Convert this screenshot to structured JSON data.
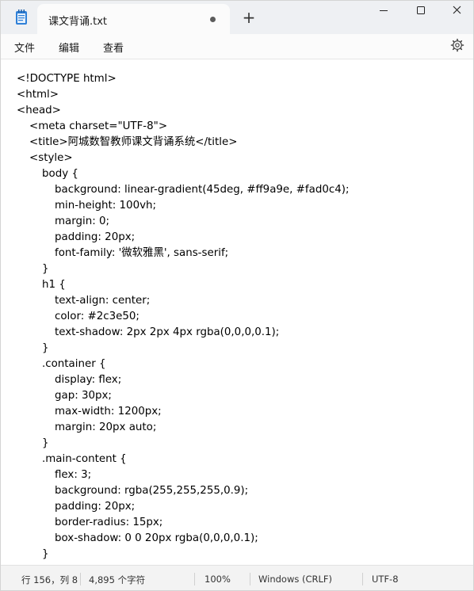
{
  "window": {
    "tab_title": "课文背诵.txt",
    "new_tab_label": "+",
    "controls": {
      "minimize": "minimize-icon",
      "maximize": "maximize-icon",
      "close": "close-icon"
    }
  },
  "menu": {
    "file": "文件",
    "edit": "编辑",
    "view": "查看",
    "settings_icon": "gear-icon"
  },
  "editor": {
    "lines": [
      "<!DOCTYPE html>",
      "<html>",
      "<head>",
      "    <meta charset=\"UTF-8\">",
      "    <title>阿城数智教师课文背诵系统</title>",
      "    <style>",
      "        body {",
      "            background: linear-gradient(45deg, #ff9a9e, #fad0c4);",
      "            min-height: 100vh;",
      "            margin: 0;",
      "            padding: 20px;",
      "            font-family: '微软雅黑', sans-serif;",
      "        }",
      "        h1 {",
      "            text-align: center;",
      "            color: #2c3e50;",
      "            text-shadow: 2px 2px 4px rgba(0,0,0,0.1);",
      "        }",
      "        .container {",
      "            display: flex;",
      "            gap: 30px;",
      "            max-width: 1200px;",
      "            margin: 20px auto;",
      "        }",
      "        .main-content {",
      "            flex: 3;",
      "            background: rgba(255,255,255,0.9);",
      "            padding: 20px;",
      "            border-radius: 15px;",
      "            box-shadow: 0 0 20px rgba(0,0,0,0.1);",
      "        }"
    ]
  },
  "status": {
    "position": "行 156，列 8",
    "char_count": "4,895 个字符",
    "zoom": "100%",
    "line_ending": "Windows (CRLF)",
    "encoding": "UTF-8"
  }
}
